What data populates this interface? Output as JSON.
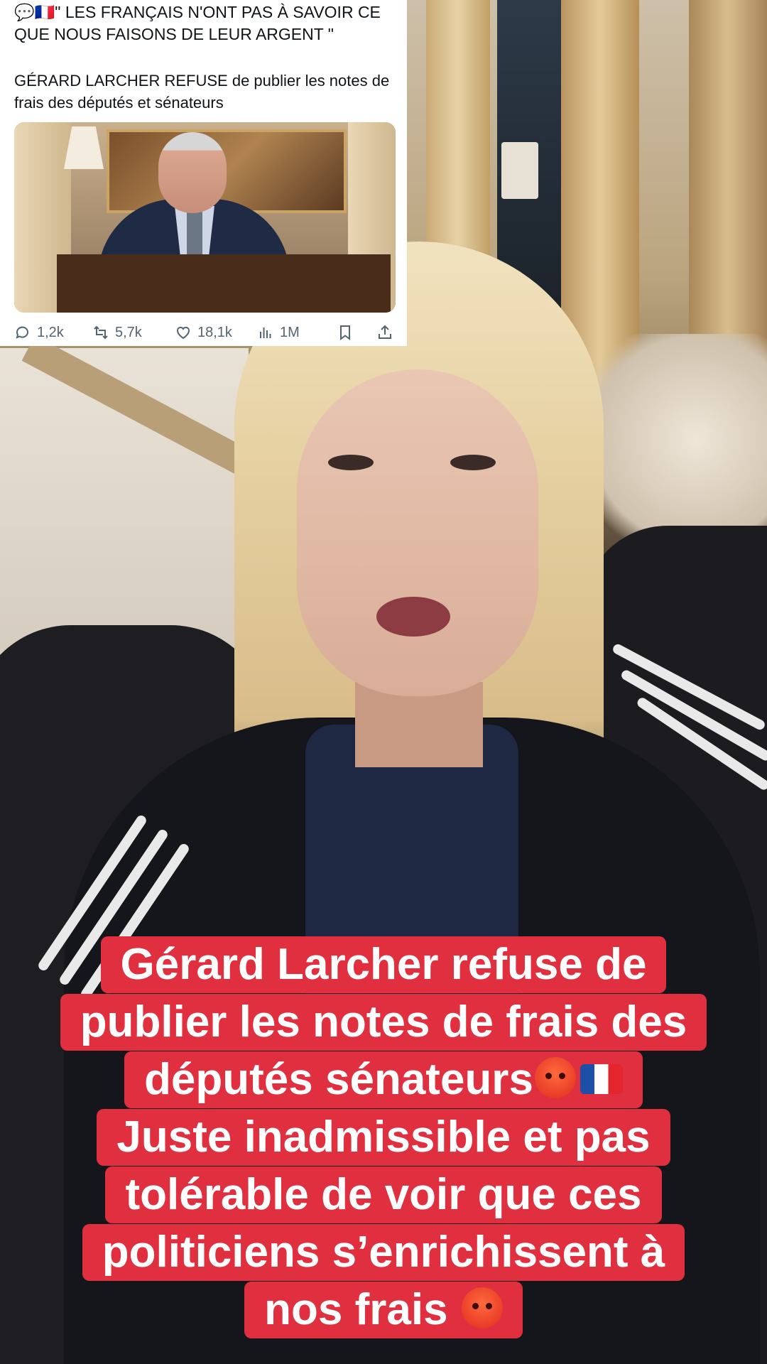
{
  "tweet": {
    "headline_icons": "💬🇫🇷",
    "headline": "\" LES FRANÇAIS N'ONT PAS À SAVOIR CE QUE NOUS FAISONS DE LEUR ARGENT \"",
    "body_bold": "GÉRARD LARCHER REFUSE",
    "body_rest": " de publier les notes de frais des députés et sénateurs",
    "actions": {
      "reply_count": "1,2k",
      "retweet_count": "5,7k",
      "like_count": "18,1k",
      "views_count": "1M"
    },
    "icons": [
      "reply-icon",
      "retweet-icon",
      "like-icon",
      "views-icon",
      "bookmark-icon",
      "share-icon"
    ]
  },
  "caption": {
    "line1": "Gérard Larcher refuse de",
    "line2": "publier les notes de frais des",
    "line3": "députés sénateurs",
    "line3_icons": [
      "angry-face-emoji",
      "france-flag-emoji"
    ],
    "line4": "Juste inadmissible et pas",
    "line5": "tolérable de voir que ces",
    "line6": "politiciens s’enrichissent à",
    "line7": "nos frais",
    "line7_icons": [
      "angry-face-emoji"
    ],
    "background_color": "#e0303f",
    "text_color": "#ffffff"
  }
}
